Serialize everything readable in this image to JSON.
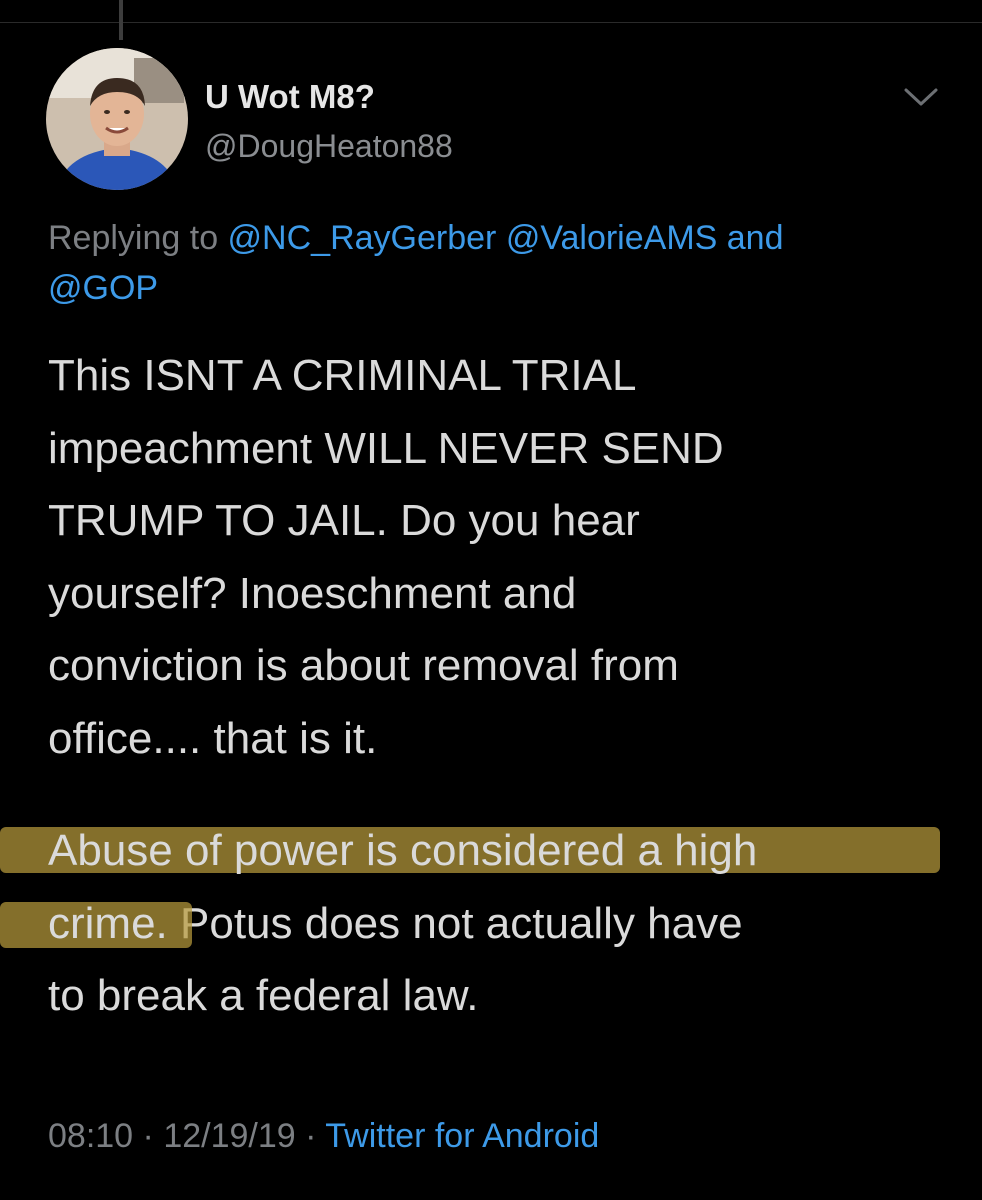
{
  "tweet": {
    "display_name": "U Wot M8?",
    "handle": "@DougHeaton88",
    "replying_prefix": "Replying to ",
    "mentions": [
      "@NC_RayGerber",
      "@ValorieAMS",
      "@GOP"
    ],
    "mentions_joiner": " and",
    "body_lines": [
      "This ISNT A CRIMINAL TRIAL",
      "impeachment WILL NEVER SEND",
      "TRUMP TO JAIL. Do you hear",
      "yourself? Inoeschment and",
      "conviction is about removal from",
      "office.... that is it."
    ],
    "highlighted_line1": "Abuse of power is considered a high",
    "highlighted_line2": "crime.",
    "rest_line2": " Potus does not actually have",
    "last_line": "to break a federal law.",
    "time": "08:10",
    "separator": " · ",
    "date": "12/19/19",
    "source": "Twitter for Android"
  },
  "icons": {
    "more": "chevron-down-icon",
    "avatar": "avatar"
  },
  "colors": {
    "background": "#000000",
    "link": "#3d9ae8",
    "secondary": "#7c7f83",
    "highlight": "#b79a3b"
  }
}
